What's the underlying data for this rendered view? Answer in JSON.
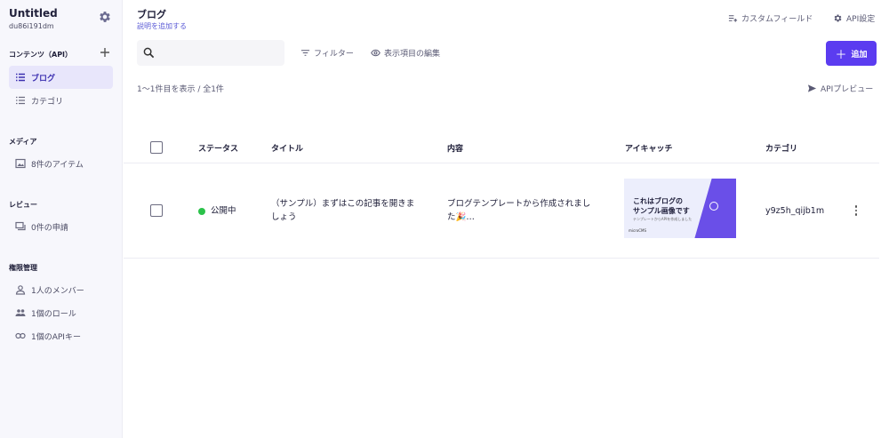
{
  "sidebar": {
    "service_name": "Untitled",
    "service_id": "du86i191dm",
    "contents_title": "コンテンツ（API）",
    "contents_items": [
      {
        "label": "ブログ",
        "icon": "list-icon",
        "active": true
      },
      {
        "label": "カテゴリ",
        "icon": "list-icon",
        "active": false
      }
    ],
    "media_title": "メディア",
    "media_item": {
      "label": "8件のアイテム",
      "icon": "image-icon"
    },
    "review_title": "レビュー",
    "review_item": {
      "label": "0件の申請",
      "icon": "review-icon"
    },
    "perm_title": "権限管理",
    "perm_items": [
      {
        "label": "1人のメンバー",
        "icon": "person-icon"
      },
      {
        "label": "1個のロール",
        "icon": "group-icon"
      },
      {
        "label": "1個のAPIキー",
        "icon": "key-icon"
      }
    ]
  },
  "header": {
    "title": "ブログ",
    "description": "説明を追加する",
    "custom_field": "カスタムフィールド",
    "api_settings": "API設定"
  },
  "toolbar": {
    "search_placeholder": "",
    "filter": "フィルター",
    "display_edit": "表示項目の編集",
    "add": "追加"
  },
  "list": {
    "count_text": "1〜1件目を表示 / 全1件",
    "api_preview": "APIプレビュー",
    "columns": [
      "ステータス",
      "タイトル",
      "内容",
      "アイキャッチ",
      "カテゴリ"
    ],
    "rows": [
      {
        "status": "公開中",
        "title_line1": "（サンプル）まずはこの記事を開きま",
        "title_line2": "しょう",
        "content_line1": "ブログテンプレートから作成されまし",
        "content_line2": "た🎉…",
        "thumb_title1": "これはブログの",
        "thumb_title2": "サンプル画像です",
        "thumb_sub": "テンプレートからAPIを作成しました",
        "thumb_logo": "microCMS",
        "category": "y9z5h_qijb1m"
      }
    ]
  },
  "colors": {
    "accent": "#5b3cf0",
    "status_published": "#2bc24a",
    "sidebar_bg": "#f7f7fc"
  }
}
